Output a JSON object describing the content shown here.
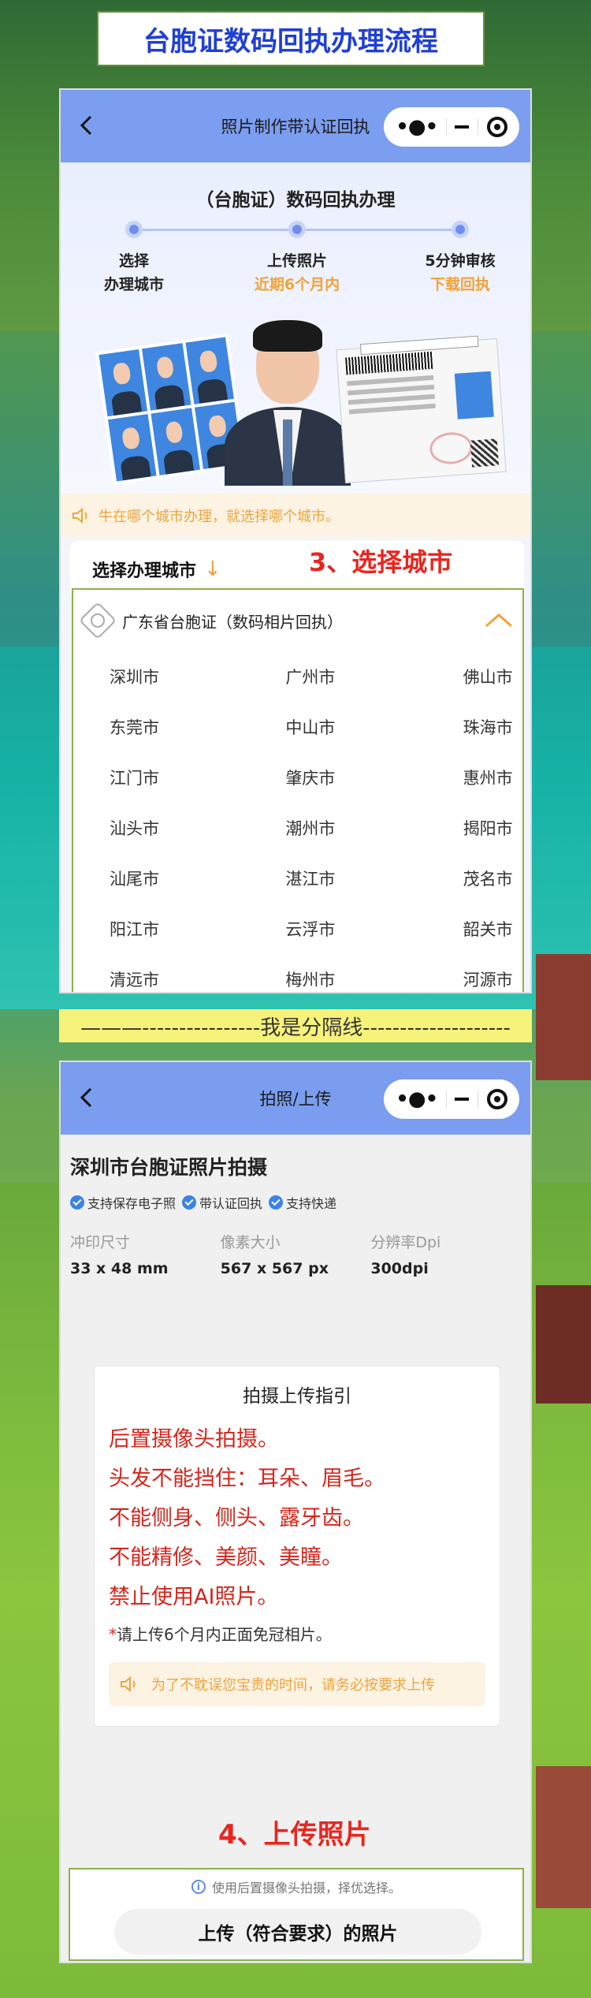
{
  "page_title": "台胞证数码回执办理流程",
  "screen1": {
    "nav_title": "照片制作带认证回执",
    "heading": "（台胞证）数码回执办理",
    "steps": [
      {
        "line1": "选择",
        "line2": "办理城市"
      },
      {
        "line1": "上传照片",
        "line2": "近期6个月内"
      },
      {
        "line1": "5分钟审核",
        "line2": "下载回执"
      }
    ],
    "notice": "牛在哪个城市办理，就选择哪个城市。",
    "select_city_label": "选择办理城市",
    "select_city_arrow": "↓",
    "annotation": "3、选择城市",
    "province": "广东省台胞证（数码相片回执）",
    "cities": [
      "深圳市",
      "广州市",
      "佛山市",
      "东莞市",
      "中山市",
      "珠海市",
      "江门市",
      "肇庆市",
      "惠州市",
      "汕头市",
      "潮州市",
      "揭阳市",
      "汕尾市",
      "湛江市",
      "茂名市",
      "阳江市",
      "云浮市",
      "韶关市",
      "清远市",
      "梅州市",
      "河源市"
    ]
  },
  "divider_text": "———----------------我是分隔线--------------------",
  "screen2": {
    "nav_title": "拍照/上传",
    "title": "深圳市台胞证照片拍摄",
    "tags": [
      "支持保存电子照",
      "带认证回执",
      "支持快递"
    ],
    "specs": [
      {
        "label": "冲印尺寸",
        "value": "33 x 48 mm"
      },
      {
        "label": "像素大小",
        "value": "567 x 567 px"
      },
      {
        "label": "分辨率Dpi",
        "value": "300dpi"
      }
    ],
    "guide_title": "拍摄上传指引",
    "guide_rules": [
      "后置摄像头拍摄。",
      "头发不能挡住：耳朵、眉毛。",
      "不能侧身、侧头、露牙齿。",
      "不能精修、美颜、美瞳。",
      "禁止使用AI照片。"
    ],
    "guide_note_star": "*",
    "guide_note": "请上传6个月内正面免冠相片。",
    "guide_warning": "为了不耽误您宝贵的时间，请务必按要求上传",
    "annotation": "4、上传照片",
    "upload_tip": "使用后置摄像头拍摄，择优选择。",
    "upload_button": "上传（符合要求）的照片"
  },
  "colors": {
    "nav": "#7c9ef0",
    "accent_orange": "#f1a23a",
    "annotation_red": "#e8261f",
    "title_blue": "#1f3fd6"
  },
  "icons": [
    "back-icon",
    "more-icon",
    "minimize-icon",
    "close-target-icon",
    "speaker-icon",
    "chevron-up-icon",
    "province-badge-icon",
    "check-circle-icon",
    "info-icon"
  ]
}
